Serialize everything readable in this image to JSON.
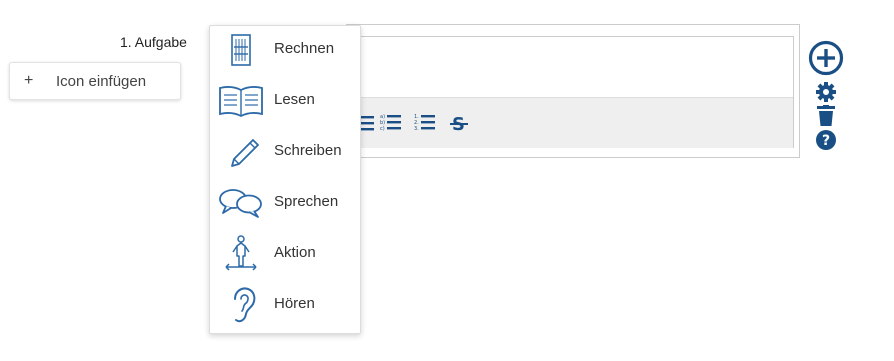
{
  "task": {
    "label": "1. Aufgabe"
  },
  "icon_button": {
    "plus": "+",
    "label": "Icon einfügen"
  },
  "dropdown": {
    "items": [
      {
        "label": "Rechnen",
        "icon": "abacus-icon"
      },
      {
        "label": "Lesen",
        "icon": "open-book-icon"
      },
      {
        "label": "Schreiben",
        "icon": "pencil-icon"
      },
      {
        "label": "Sprechen",
        "icon": "speech-bubbles-icon"
      },
      {
        "label": "Aktion",
        "icon": "action-figure-icon"
      },
      {
        "label": "Hören",
        "icon": "ear-icon"
      }
    ]
  },
  "toolbar": {
    "buttons": [
      {
        "icon": "bullet-list-icon"
      },
      {
        "icon": "lettered-list-icon",
        "text": "a) b) c)"
      },
      {
        "icon": "numbered-list-icon",
        "text": "1. 2. 3."
      },
      {
        "icon": "strikethrough-icon",
        "text": "S"
      }
    ]
  },
  "side_tools": [
    {
      "icon": "add-circle-icon"
    },
    {
      "icon": "gear-icon"
    },
    {
      "icon": "trash-icon"
    },
    {
      "icon": "help-icon"
    }
  ],
  "colors": {
    "accent": "#1a4f86",
    "icon_blue": "#2d6aa8",
    "toolbar_bg": "#efefef"
  }
}
